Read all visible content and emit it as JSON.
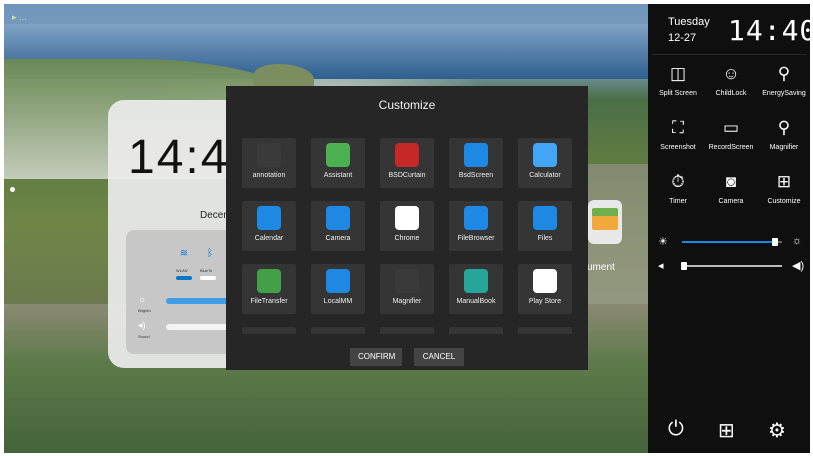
{
  "wallpaper": {
    "status_text": "▸ ..."
  },
  "widget": {
    "clock": "14:4",
    "date": "Decem",
    "toggles": [
      {
        "label": "WLAN",
        "icon": "wifi-icon"
      },
      {
        "label": "BlueTo",
        "icon": "bluetooth-icon"
      }
    ],
    "brightness_label": "Brightn",
    "sound_label": "Sound"
  },
  "file_card": {
    "label": "cument"
  },
  "dialog": {
    "title": "Customize",
    "apps": [
      {
        "label": "annotation",
        "icon": "annotation-icon",
        "color": "#3a3a3a"
      },
      {
        "label": "Assistant",
        "icon": "assistant-icon",
        "color": "#4caf50"
      },
      {
        "label": "BSDCurtain",
        "icon": "curtain-icon",
        "color": "#c62828"
      },
      {
        "label": "BsdScreen",
        "icon": "bsdscreen-icon",
        "color": "#1e88e5"
      },
      {
        "label": "Calculator",
        "icon": "calculator-icon",
        "color": "#42a5f5"
      },
      {
        "label": "Calendar",
        "icon": "calendar-icon",
        "color": "#1e88e5"
      },
      {
        "label": "Camera",
        "icon": "camera-icon",
        "color": "#1e88e5"
      },
      {
        "label": "Chrome",
        "icon": "chrome-icon",
        "color": "#ffffff"
      },
      {
        "label": "FileBrowser",
        "icon": "filebrowser-icon",
        "color": "#1e88e5"
      },
      {
        "label": "Files",
        "icon": "files-icon",
        "color": "#1e88e5"
      },
      {
        "label": "FileTransfer",
        "icon": "filetransfer-icon",
        "color": "#43a047"
      },
      {
        "label": "LocalMM",
        "icon": "localmm-icon",
        "color": "#1e88e5"
      },
      {
        "label": "Magnifier",
        "icon": "magnifier-icon",
        "color": "#3a3a3a"
      },
      {
        "label": "ManualBook",
        "icon": "manualbook-icon",
        "color": "#26a69a"
      },
      {
        "label": "Play Store",
        "icon": "playstore-icon",
        "color": "#ffffff"
      }
    ],
    "confirm_label": "CONFIRM",
    "cancel_label": "CANCEL"
  },
  "panel": {
    "day": "Tuesday",
    "date": "12-27",
    "time": "14:40",
    "tiles": [
      {
        "label": "Split Screen",
        "icon": "split-screen-icon",
        "glyph": "◫"
      },
      {
        "label": "ChildLock",
        "icon": "childlock-icon",
        "glyph": "☺"
      },
      {
        "label": "EnergySaving",
        "icon": "energy-saving-icon",
        "glyph": "⚲"
      },
      {
        "label": "Screenshot",
        "icon": "screenshot-icon",
        "glyph": "⛶"
      },
      {
        "label": "RecordScreen",
        "icon": "record-screen-icon",
        "glyph": "▭"
      },
      {
        "label": "Magnifier",
        "icon": "magnifier-icon",
        "glyph": "⚲"
      },
      {
        "label": "Timer",
        "icon": "timer-icon",
        "glyph": "⏱"
      },
      {
        "label": "Camera",
        "icon": "camera-icon",
        "glyph": "◙"
      },
      {
        "label": "Customize",
        "icon": "customize-icon",
        "glyph": "⊞"
      }
    ],
    "brightness_level": 0.93,
    "volume_level": 0.02,
    "colors": {
      "accent": "#1e88e5",
      "panel_bg": "#0f0f10"
    }
  }
}
